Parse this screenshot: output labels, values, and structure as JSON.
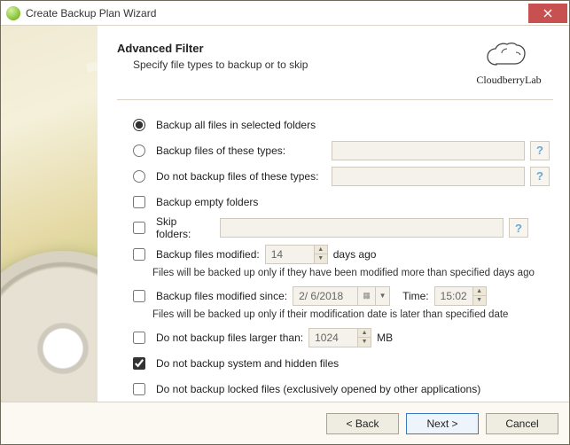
{
  "window": {
    "title": "Create Backup Plan Wizard"
  },
  "brand": {
    "name": "CloudberryLab"
  },
  "header": {
    "title": "Advanced Filter",
    "subtitle": "Specify file types to backup or to skip"
  },
  "filter": {
    "opt_all": "Backup all files in selected folders",
    "opt_types": "Backup files of these types:",
    "opt_not_types": "Do not backup files of these types:",
    "types_value": "",
    "not_types_value": "",
    "help_glyph": "?",
    "chk_empty": "Backup empty folders",
    "chk_skip": "Skip folders:",
    "skip_value": "",
    "chk_modified": "Backup files modified:",
    "modified_days": "14",
    "days_ago_label": "days ago",
    "modified_note": "Files will be backed up only if they have been modified more than specified days ago",
    "chk_since": "Backup files modified since:",
    "since_date": "2/ 6/2018",
    "time_label": "Time:",
    "since_time": "15:02",
    "since_note": "Files will be backed up only if their modification date is later than specified date",
    "chk_larger": "Do not backup files larger than:",
    "larger_value": "1024",
    "larger_unit": "MB",
    "chk_system": "Do not backup system and hidden files",
    "chk_locked": "Do not backup locked files (exclusively opened by other applications)"
  },
  "buttons": {
    "back": "< Back",
    "next": "Next >",
    "cancel": "Cancel"
  }
}
